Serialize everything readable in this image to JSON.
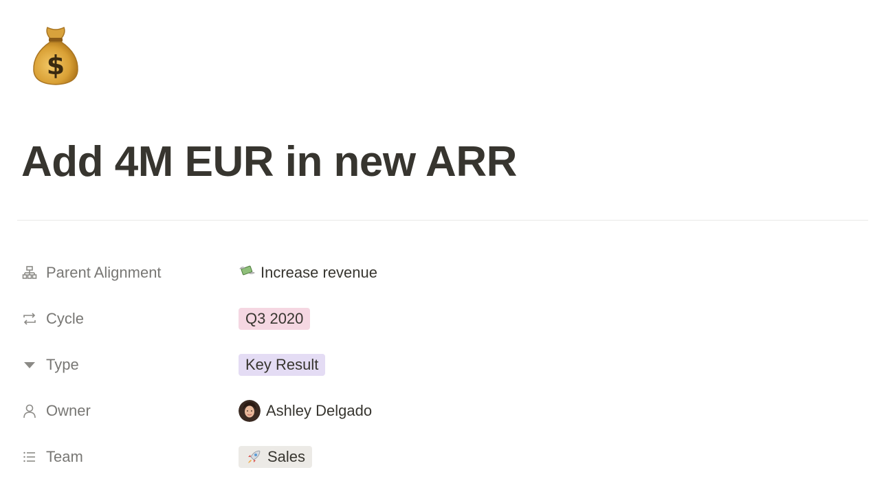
{
  "page": {
    "icon": "money-bag-icon",
    "title": "Add 4M EUR in new ARR"
  },
  "properties": [
    {
      "name": "Parent Alignment",
      "icon": "hierarchy-icon",
      "value": "Increase revenue",
      "value_icon": "money-with-wings-icon"
    },
    {
      "name": "Cycle",
      "icon": "repeat-icon",
      "value": "Q3 2020",
      "tag_color": "#f5d7e2"
    },
    {
      "name": "Type",
      "icon": "select-triangle-icon",
      "value": "Key Result",
      "tag_color": "#e4dcf4"
    },
    {
      "name": "Owner",
      "icon": "person-icon",
      "value": "Ashley Delgado",
      "value_icon": "avatar"
    },
    {
      "name": "Team",
      "icon": "list-icon",
      "value": "Sales",
      "value_icon": "rocket-icon",
      "tag_color": "#eceae6"
    }
  ],
  "colors": {
    "text": "#37352f",
    "muted": "#787774",
    "divider": "#e9e9e7"
  }
}
